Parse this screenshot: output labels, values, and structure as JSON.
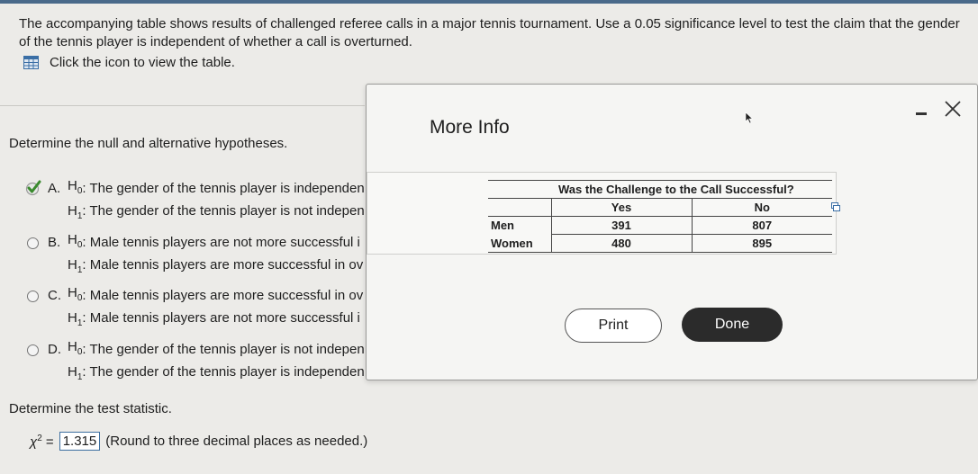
{
  "question": {
    "prompt": "The accompanying table shows results of challenged referee calls in a major tennis tournament. Use a 0.05 significance level to test the claim that the gender of the tennis player is independent of whether a call is overturned.",
    "table_link_text": "Click the icon to view the table."
  },
  "part1": {
    "label": "Determine the null and alternative hypotheses.",
    "options": [
      {
        "letter": "A.",
        "h0": ": The gender of the tennis player is independen",
        "h1": ": The gender of the tennis player is not indepen",
        "selected": true
      },
      {
        "letter": "B.",
        "h0": ": Male tennis players are not more successful i",
        "h1": ": Male tennis players are more successful in ov",
        "selected": false
      },
      {
        "letter": "C.",
        "h0": ": Male tennis players are more successful in ov",
        "h1": ": Male tennis players are not more successful i",
        "selected": false
      },
      {
        "letter": "D.",
        "h0": ": The gender of the tennis player is not indepen",
        "h1": ": The gender of the tennis player is independen",
        "selected": false
      }
    ]
  },
  "part2": {
    "label": "Determine the test statistic.",
    "answer_value": "1.315",
    "answer_note": "(Round to three decimal places as needed.)"
  },
  "modal": {
    "title": "More Info",
    "table": {
      "header": "Was the Challenge to the Call Successful?",
      "columns": [
        "Yes",
        "No"
      ],
      "rows": [
        {
          "label": "Men",
          "values": [
            "391",
            "807"
          ]
        },
        {
          "label": "Women",
          "values": [
            "480",
            "895"
          ]
        }
      ]
    },
    "print_label": "Print",
    "done_label": "Done"
  }
}
